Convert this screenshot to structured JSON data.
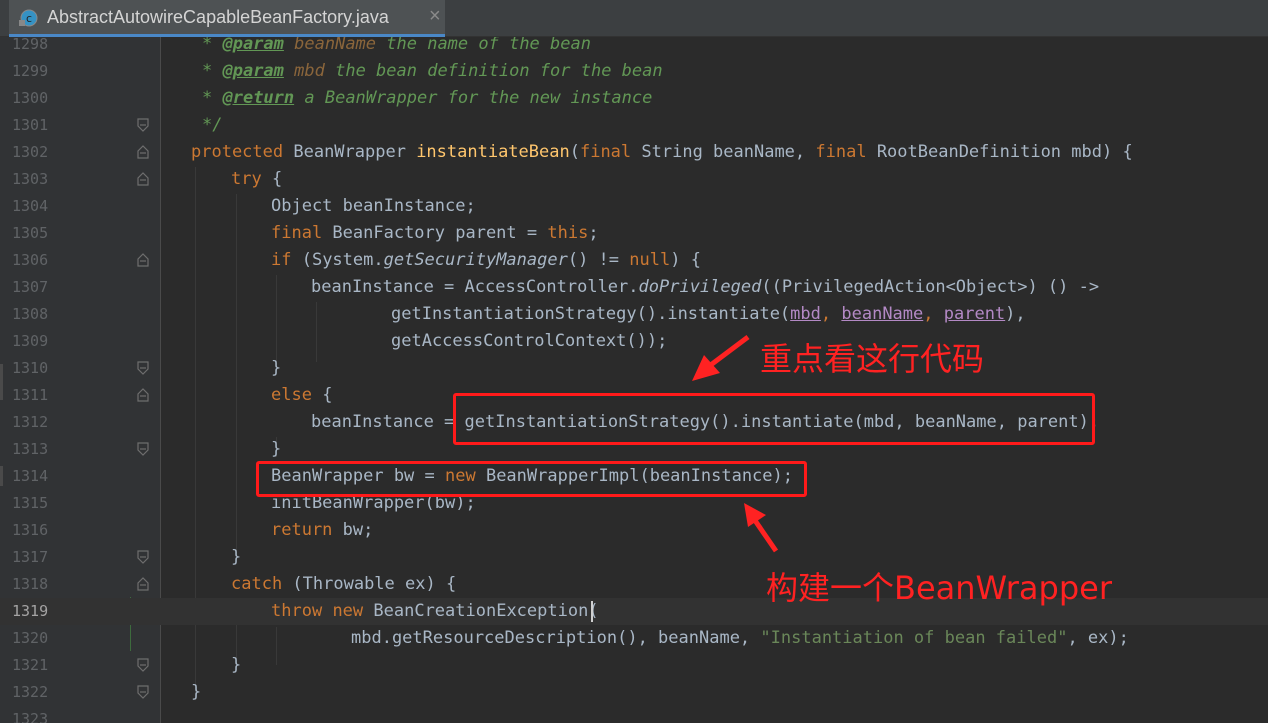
{
  "tab": {
    "title": "AbstractAutowireCapableBeanFactory.java",
    "close": "×",
    "icon": "java-class-icon"
  },
  "lines": [
    {
      "num": "1298"
    },
    {
      "num": "1299"
    },
    {
      "num": "1300"
    },
    {
      "num": "1301"
    },
    {
      "num": "1302"
    },
    {
      "num": "1303"
    },
    {
      "num": "1304"
    },
    {
      "num": "1305"
    },
    {
      "num": "1306"
    },
    {
      "num": "1307"
    },
    {
      "num": "1308"
    },
    {
      "num": "1309"
    },
    {
      "num": "1310"
    },
    {
      "num": "1311"
    },
    {
      "num": "1312"
    },
    {
      "num": "1313"
    },
    {
      "num": "1314"
    },
    {
      "num": "1315"
    },
    {
      "num": "1316"
    },
    {
      "num": "1317"
    },
    {
      "num": "1318"
    },
    {
      "num": "1319"
    },
    {
      "num": "1320"
    },
    {
      "num": "1321"
    },
    {
      "num": "1322"
    },
    {
      "num": "1323"
    }
  ],
  "code": {
    "l1298": {
      "star": "* ",
      "tag": "@param",
      "name": " beanName",
      "text": " the name of the bean"
    },
    "l1299": {
      "star": "* ",
      "tag": "@param",
      "name": " mbd",
      "text": " the bean definition for the bean"
    },
    "l1300": {
      "star": "* ",
      "tag": "@return",
      "text": " a BeanWrapper for the new instance"
    },
    "l1301": {
      "text": "*/"
    },
    "l1302": {
      "kw1": "protected",
      "t1": " BeanWrapper ",
      "fn": "instantiateBean",
      "t2": "(",
      "kw2": "final",
      "t3": " String beanName, ",
      "kw3": "final",
      "t4": " RootBeanDefinition mbd) {"
    },
    "l1303": {
      "kw": "try",
      "t": " {"
    },
    "l1304": {
      "t": "Object beanInstance;"
    },
    "l1305": {
      "kw": "final",
      "t1": " BeanFactory parent = ",
      "kw2": "this",
      "t2": ";"
    },
    "l1306": {
      "kw": "if",
      "t1": " (System.",
      "m": "getSecurityManager",
      "t2": "() != ",
      "kw2": "null",
      "t3": ") {"
    },
    "l1307": {
      "t1": "beanInstance = AccessController.",
      "m": "doPrivileged",
      "t2": "((PrivilegedAction<Object>) () ->"
    },
    "l1308": {
      "t1": "getInstantiationStrategy().instantiate(",
      "p1": "mbd",
      "c1": ", ",
      "p2": "beanName",
      "c2": ", ",
      "p3": "parent",
      "t2": "),"
    },
    "l1309": {
      "t": "getAccessControlContext());"
    },
    "l1310": {
      "t": "}"
    },
    "l1311": {
      "kw": "else",
      "t": " {"
    },
    "l1312": {
      "t1": "beanInstance = ",
      "t2": "getInstantiationStrategy().instantiate(mbd, beanName, parent);"
    },
    "l1313": {
      "t": "}"
    },
    "l1314": {
      "t1": "BeanWrapper bw = ",
      "kw": "new",
      "t2": " BeanWrapperImpl(beanInstance);"
    },
    "l1315": {
      "t": "initBeanWrapper(bw);"
    },
    "l1316": {
      "kw": "return",
      "t": " bw;"
    },
    "l1317": {
      "t": "}"
    },
    "l1318": {
      "kw": "catch",
      "t": " (Throwable ex) {"
    },
    "l1319": {
      "kw1": "throw",
      "t1": " ",
      "kw2": "new",
      "t2": " BeanCreationException("
    },
    "l1320": {
      "t1": "mbd.getResourceDescription(), beanName, ",
      "s": "\"Instantiation of bean failed\"",
      "t2": ", ex);"
    },
    "l1321": {
      "t": "}"
    },
    "l1322": {
      "t": "}"
    }
  },
  "annotations": {
    "focus_line": "重点看这行代码",
    "build_wrapper": "构建一个BeanWrapper"
  },
  "colors": {
    "keyword": "#cc7832",
    "method": "#ffc66d",
    "doc": "#629755",
    "string": "#6a8759",
    "annotation_red": "#ff2222"
  }
}
